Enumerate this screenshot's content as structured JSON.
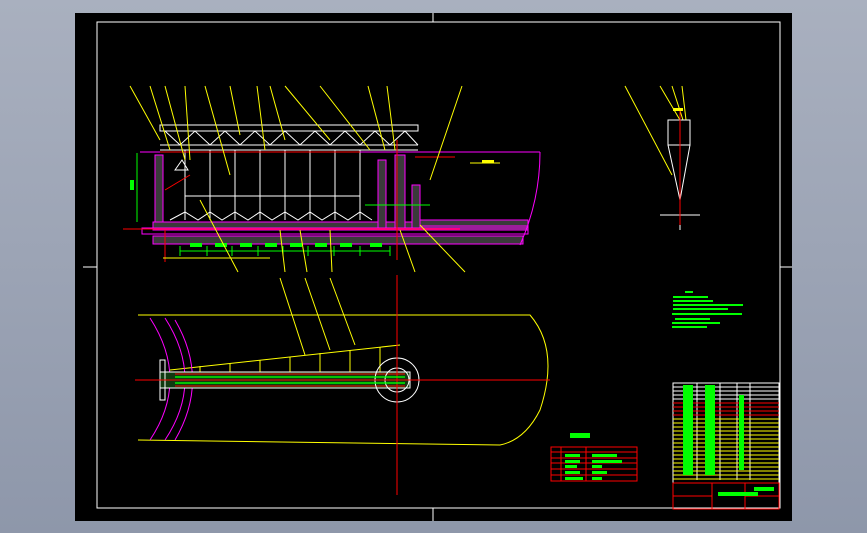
{
  "viewer": {
    "background": "#000000",
    "colors": {
      "frame": "#ffffff",
      "structure": "#ffffff",
      "concrete": "#ff00ff",
      "dimension": "#00ff00",
      "leader": "#ffff00",
      "centerline": "#ff0000"
    }
  },
  "drawing": {
    "views": [
      "elevation-section",
      "plan-view",
      "detail-view"
    ],
    "icon": "cad-drawing"
  }
}
